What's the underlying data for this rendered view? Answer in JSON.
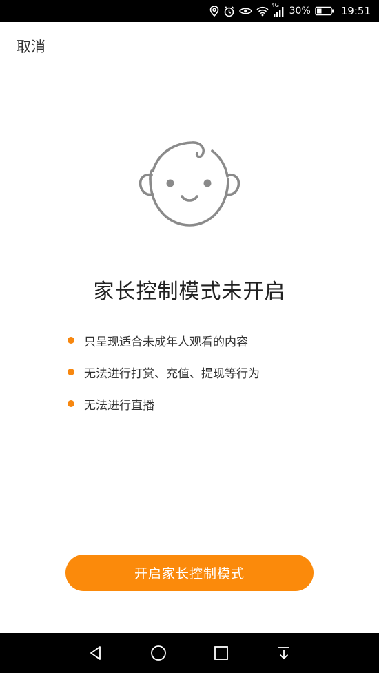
{
  "status_bar": {
    "network": "4G",
    "battery": "30%",
    "time": "19:51",
    "icons": [
      "location-icon",
      "alarm-icon",
      "eye-icon",
      "wifi-icon",
      "signal-icon",
      "battery-icon"
    ]
  },
  "header": {
    "cancel_label": "取消"
  },
  "main": {
    "illustration_icon": "baby-face-icon",
    "title": "家长控制模式未开启",
    "features": [
      "只呈现适合未成年人观看的内容",
      "无法进行打赏、充值、提现等行为",
      "无法进行直播"
    ],
    "bullet_color": "#f7870f"
  },
  "action": {
    "enable_label": "开启家长控制模式",
    "color": "#fb8a0b"
  },
  "nav_bar": {
    "icons": [
      "back-icon",
      "home-icon",
      "recents-icon",
      "notification-pull-icon"
    ]
  }
}
